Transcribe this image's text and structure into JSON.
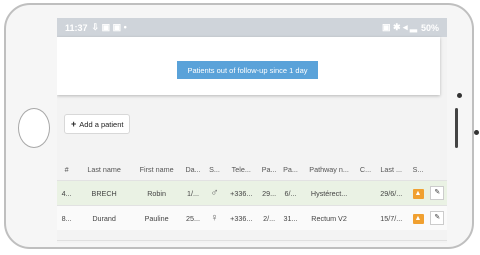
{
  "statusbar": {
    "time": "11:37",
    "left_icons": "⇩ ▣ ▣ •",
    "right_icons": "▣ ✱ ◂ ▂",
    "battery": "50%"
  },
  "alert": {
    "label": "Patients out of follow-up since 1 day"
  },
  "add_patient": {
    "plus": "+",
    "label": "Add a patient"
  },
  "table": {
    "headers": [
      "#",
      "Last name",
      "First name",
      "Da...",
      "S...",
      "Tele...",
      "Pa...",
      "Pa...",
      "Pathway n...",
      "C...",
      "Last ...",
      "S..."
    ],
    "rows": [
      {
        "num": "4...",
        "last": "BRECH",
        "first": "Robin",
        "da": "1/...",
        "sex": "♂",
        "tel": "+336...",
        "pa1": "29...",
        "pa2": "6/...",
        "pathway": "Hystérect...",
        "c": "",
        "last_date": "29/6/...",
        "status_icon": "warning-icon",
        "edit_icon": "pencil-icon"
      },
      {
        "num": "8...",
        "last": "Durand",
        "first": "Pauline",
        "da": "25...",
        "sex": "♀",
        "tel": "+336...",
        "pa1": "2/...",
        "pa2": "31...",
        "pathway": "Rectum V2",
        "c": "",
        "last_date": "15/7/...",
        "status_icon": "warning-icon",
        "edit_icon": "pencil-icon"
      }
    ]
  },
  "colors": {
    "alert_blue": "#5aa2d9",
    "row_highlight": "#eaf2e4",
    "warning_orange": "#f0a030",
    "statusbar": "#cfd4da"
  }
}
